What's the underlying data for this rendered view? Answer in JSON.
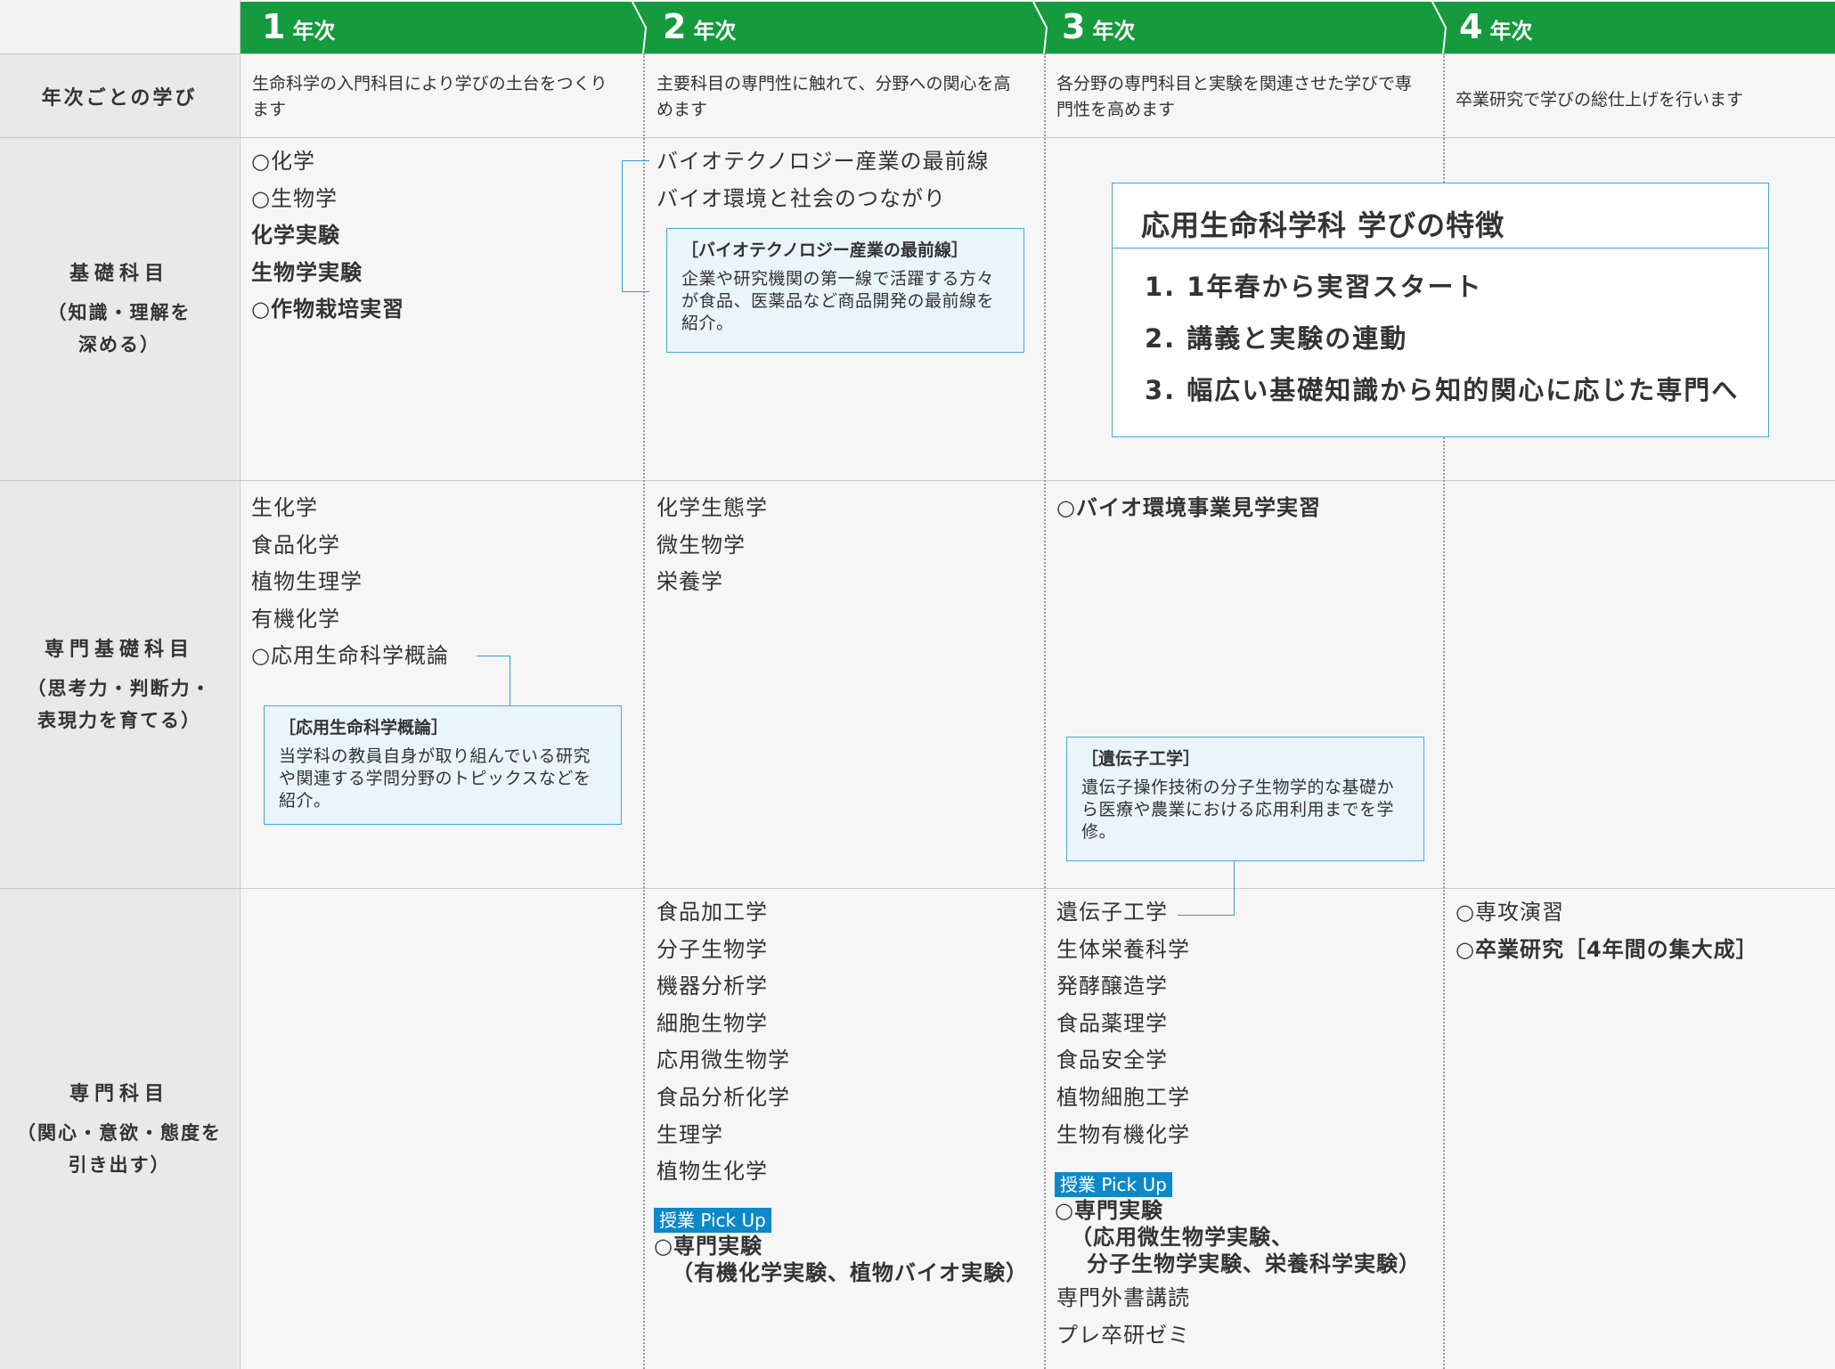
{
  "years": [
    "1",
    "2",
    "3",
    "4"
  ],
  "year_suffix": "年次",
  "rows": {
    "learning": {
      "title": "年次ごとの学び"
    },
    "kiso": {
      "title": "基礎科目",
      "sub": "（知識・理解を\n深める）"
    },
    "senmon_kiso": {
      "title": "専門基礎科目",
      "sub": "（思考力・判断力・\n表現力を育てる）"
    },
    "senmon": {
      "title": "専門科目",
      "sub": "（関心・意欲・態度を\n引き出す）"
    }
  },
  "descriptions": [
    "生命科学の入門科目により学びの土台をつくります",
    "主要科目の専門性に触れて、分野への関心を高めます",
    "各分野の専門科目と実験を関連させた学びで専門性を高めます",
    "卒業研究で学びの総仕上げを行います"
  ],
  "kiso": {
    "y1": [
      "○化学",
      "○生物学",
      "化学実験",
      "生物学実験",
      "○作物栽培実習"
    ],
    "y2": [
      "バイオテクノロジー産業の最前線",
      "バイオ環境と社会のつながり"
    ]
  },
  "notes": {
    "biotech": {
      "title": "［バイオテクノロジー産業の最前線］",
      "body": "企業や研究機関の第一線で活躍する方々が食品、医薬品など商品開発の最前線を紹介。"
    },
    "gairon": {
      "title": "［応用生命科学概論］",
      "body": "当学科の教員自身が取り組んでいる研究や関連する学問分野のトピックスなどを紹介。"
    },
    "idenshi": {
      "title": "［遺伝子工学］",
      "body": "遺伝子操作技術の分子生物学的な基礎から医療や農業における応用利用までを学修。"
    }
  },
  "feature": {
    "title": "応用生命科学科 学びの特徴",
    "items": [
      "1.  1年春から実習スタート",
      "2.  講義と実験の連動",
      "3.  幅広い基礎知識から知的関心に応じた専門へ"
    ]
  },
  "senmon_kiso": {
    "y1": [
      "生化学",
      "食品化学",
      "植物生理学",
      "有機化学",
      "○応用生命科学概論"
    ],
    "y2": [
      "化学生態学",
      "微生物学",
      "栄養学"
    ],
    "y3": [
      "○バイオ環境事業見学実習"
    ]
  },
  "senmon": {
    "y2": [
      "食品加工学",
      "分子生物学",
      "機器分析学",
      "細胞生物学",
      "応用微生物学",
      "食品分析化学",
      "生理学",
      "植物生化学"
    ],
    "y2_pickup": "授業 Pick Up",
    "y2_pick_main": "○専門実験",
    "y2_pick_detail": "（有機化学実験、植物バイオ実験）",
    "y3": [
      "遺伝子工学",
      "生体栄養科学",
      "発酵醸造学",
      "食品薬理学",
      "食品安全学",
      "植物細胞工学",
      "生物有機化学"
    ],
    "y3_pickup": "授業 Pick Up",
    "y3_pick_main": "○専門実験",
    "y3_pick_detail1": "（応用微生物学実験、",
    "y3_pick_detail2": "分子生物学実験、栄養科学実験）",
    "y3_after": [
      "専門外書講読",
      "プレ卒研ゼミ"
    ],
    "y4": [
      "○専攻演習",
      "○卒業研究［4年間の集大成］"
    ]
  },
  "colors": {
    "header_green": "#159a3e",
    "note_border": "#4aa6d8",
    "pickup_blue": "#0f88c9"
  }
}
